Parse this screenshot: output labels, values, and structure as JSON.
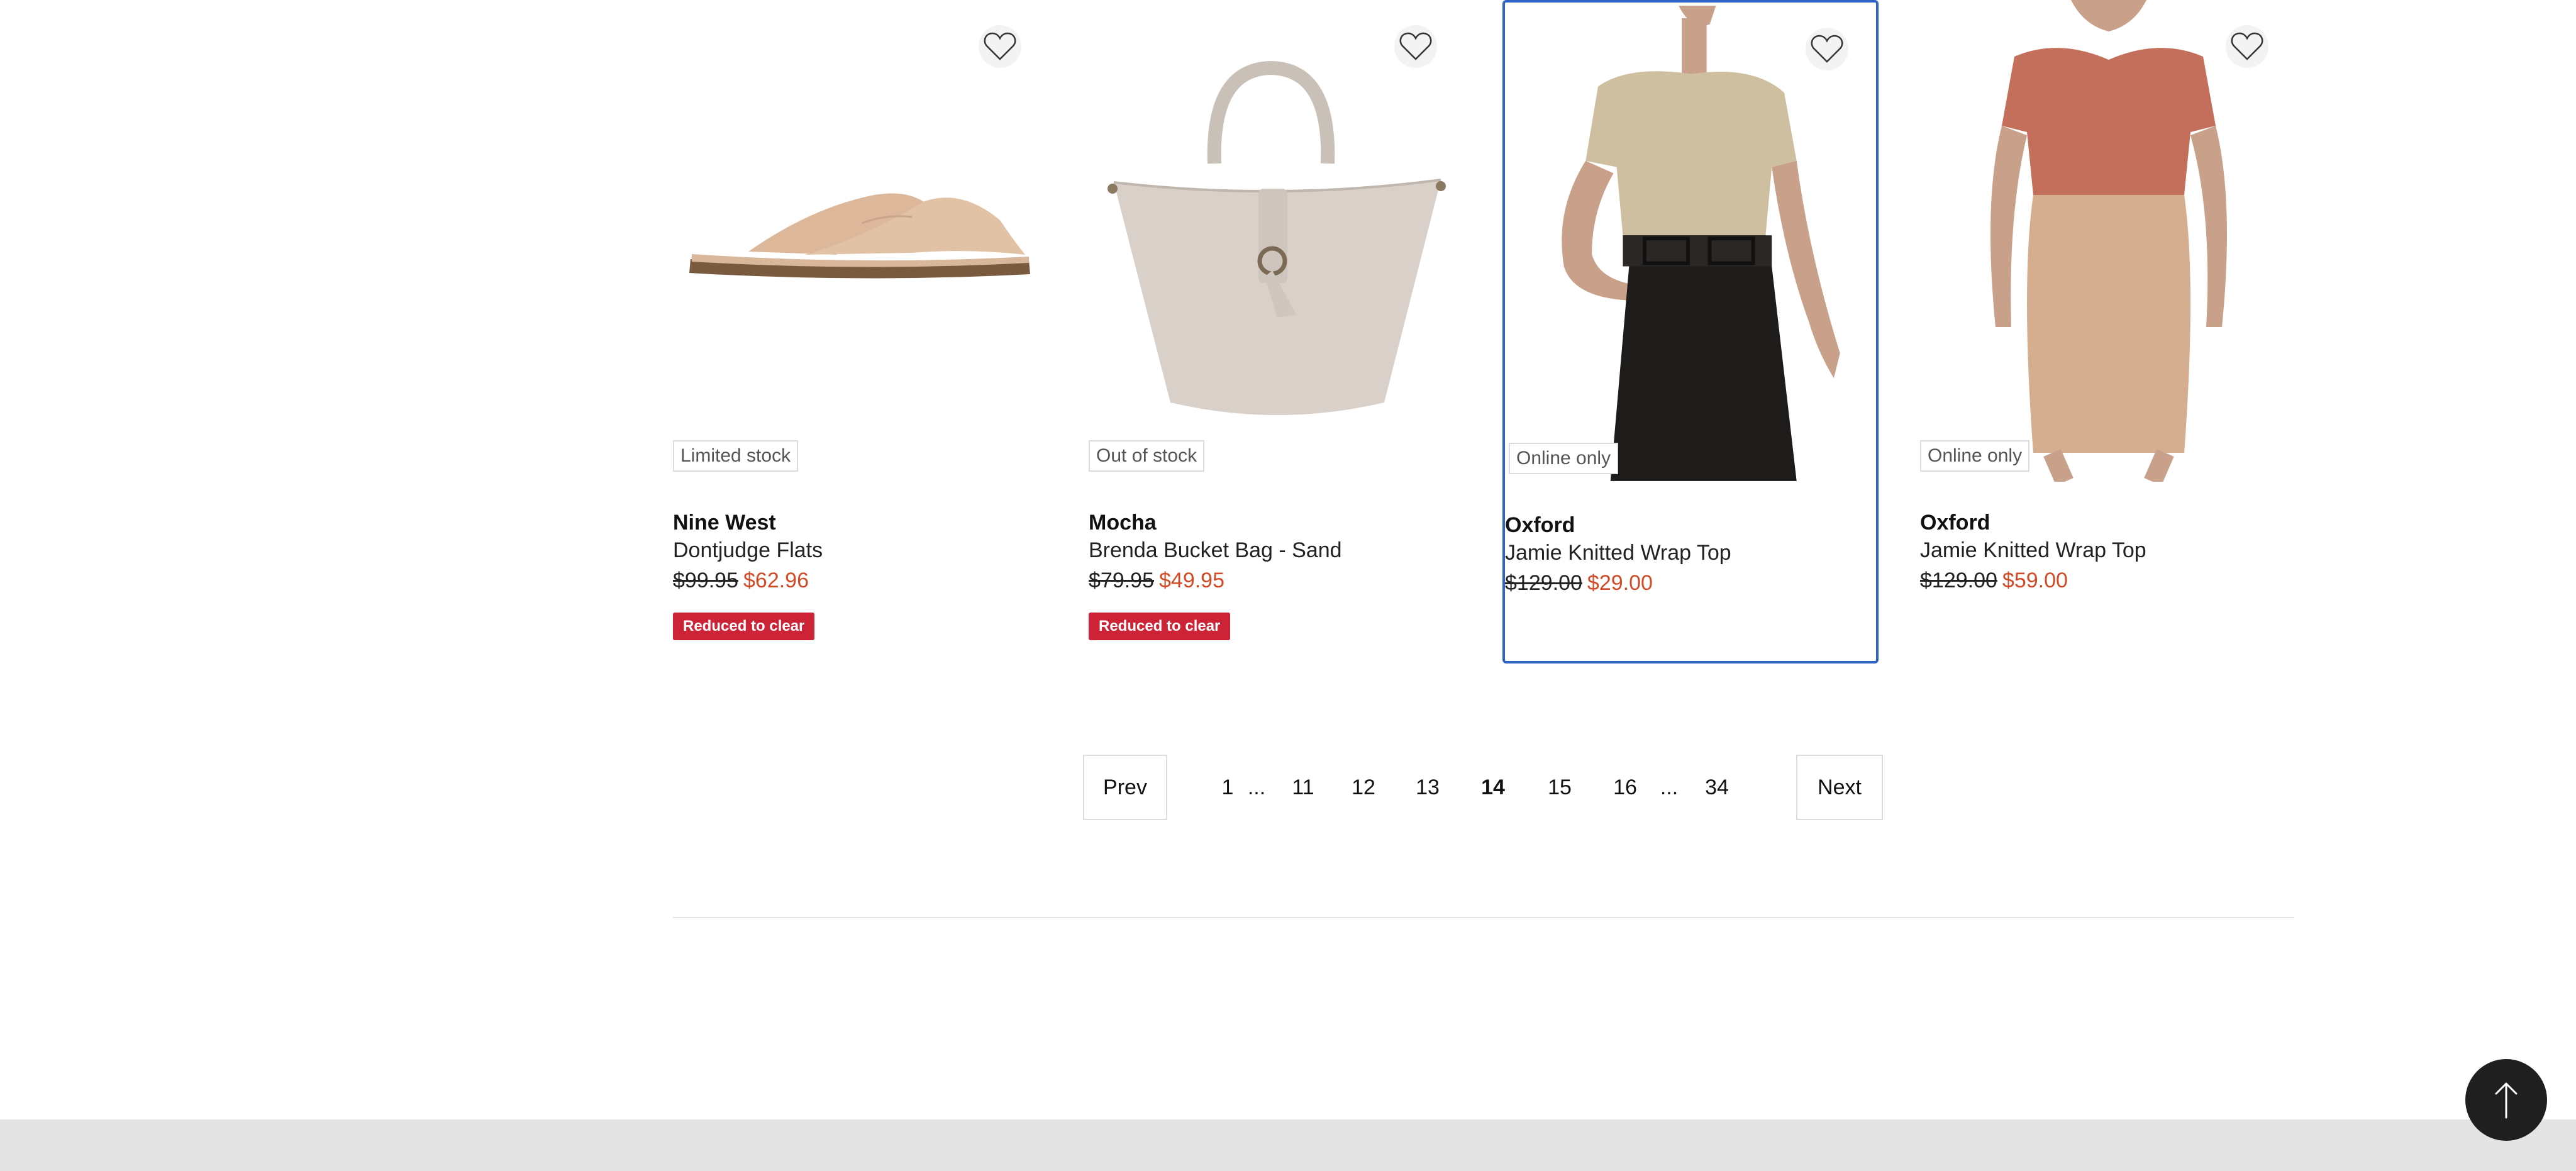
{
  "products": [
    {
      "brand": "Nine West",
      "name": "Dontjudge Flats",
      "was": "$99.95",
      "now": "$62.96",
      "stock": "Limited stock",
      "tag": "Reduced to clear",
      "icon": "sandal-product-image"
    },
    {
      "brand": "Mocha",
      "name": "Brenda Bucket Bag - Sand",
      "was": "$79.95",
      "now": "$49.95",
      "stock": "Out of stock",
      "tag": "Reduced to clear",
      "icon": "bucket-bag-product-image"
    },
    {
      "brand": "Oxford",
      "name": "Jamie Knitted Wrap Top",
      "was": "$129.00",
      "now": "$29.00",
      "stock": "Online only",
      "tag": "",
      "icon": "model-beige-top-product-image"
    },
    {
      "brand": "Oxford",
      "name": "Jamie Knitted Wrap Top",
      "was": "$129.00",
      "now": "$59.00",
      "stock": "Online only",
      "tag": "",
      "icon": "model-rust-top-product-image"
    }
  ],
  "pagination": {
    "prev": "Prev",
    "next": "Next",
    "ellipsis": "...",
    "pages": [
      "1",
      "11",
      "12",
      "13",
      "14",
      "15",
      "16",
      "34"
    ],
    "current": "14"
  },
  "colors": {
    "sale_price": "#d24b27",
    "tag_bg": "#cc2436",
    "selected_border": "#2f63c4"
  },
  "icons": {
    "wishlist": "heart-icon",
    "back_to_top": "arrow-up-icon"
  }
}
